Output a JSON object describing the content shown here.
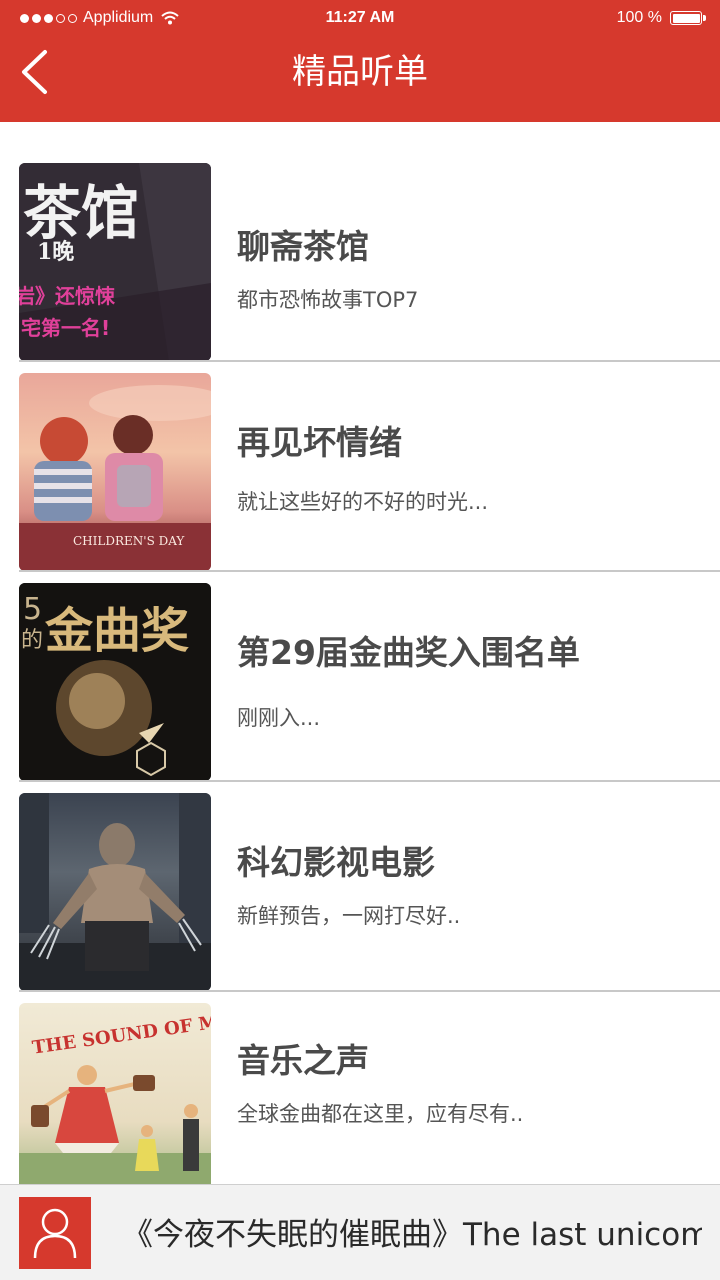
{
  "status_bar": {
    "carrier": "Applidium",
    "time": "11:27 AM",
    "battery": "100 %"
  },
  "header": {
    "title": "精品听单"
  },
  "list": {
    "items": [
      {
        "title": "聊斋茶馆",
        "subtitle": "都市恐怖故事TOP7",
        "thumb_text": [
          "茶馆",
          "1晚",
          "岩》还惊悚",
          "宅第一名!"
        ]
      },
      {
        "title": "再见坏情绪",
        "subtitle": "就让这些好的不好的时光...",
        "thumb_text": [
          "CHILDREN'S DAY"
        ]
      },
      {
        "title": "第29届金曲奖入围名单",
        "subtitle": "刚刚入...",
        "thumb_text": [
          "5",
          "的",
          "金曲奖"
        ]
      },
      {
        "title": "科幻影视电影",
        "subtitle": "新鲜预告，一网打尽好.."
      },
      {
        "title": "音乐之声",
        "subtitle": "全球金曲都在这里，应有尽有..",
        "thumb_text": [
          "THE SOUND OF MUSIC"
        ]
      }
    ]
  },
  "player": {
    "now_playing": "《今夜不失眠的催眠曲》The last unicom .."
  },
  "colors": {
    "brand": "#d6392d"
  }
}
